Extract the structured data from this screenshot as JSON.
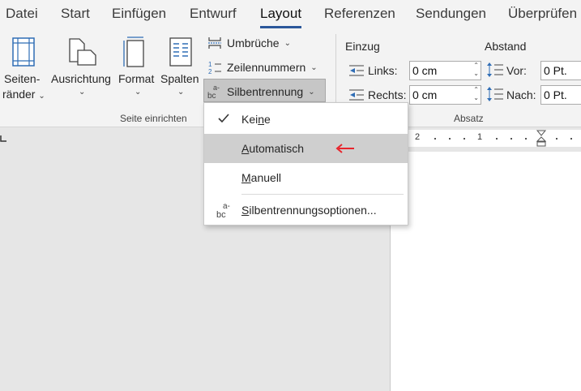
{
  "tabs": [
    "Datei",
    "Start",
    "Einfügen",
    "Entwurf",
    "Layout",
    "Referenzen",
    "Sendungen",
    "Überprüfen"
  ],
  "active_tab": "Layout",
  "ribbon": {
    "seitenraender_line1": "Seiten-",
    "seitenraender_line2": "ränder",
    "ausrichtung": "Ausrichtung",
    "format": "Format",
    "spalten": "Spalten",
    "umbrueche": "Umbrüche",
    "zeilennummern": "Zeilennummern",
    "silbentrennung": "Silbentrennung",
    "group_seite": "Seite einrichten",
    "einzug": "Einzug",
    "abstand": "Abstand",
    "links_label": "Links:",
    "links_value": "0 cm",
    "rechts_label": "Rechts:",
    "rechts_value": "0 cm",
    "vor_label": "Vor:",
    "vor_value": "0 Pt.",
    "nach_label": "Nach:",
    "nach_value": "0 Pt.",
    "group_absatz": "Absatz"
  },
  "menu": {
    "items": [
      {
        "pre": "Kei",
        "ul": "n",
        "post": "e",
        "checked": true
      },
      {
        "pre": "",
        "ul": "A",
        "post": "utomatisch",
        "highlighted": true
      },
      {
        "pre": "",
        "ul": "M",
        "post": "anuell"
      },
      {
        "pre": "",
        "ul": "S",
        "post": "ilbentrennungsoptionen..."
      }
    ]
  },
  "ruler": {
    "labels": [
      "2",
      "1"
    ]
  },
  "colors": {
    "accent": "#2b579a",
    "arrow": "#e8242c",
    "highlight": "#cfcfcf",
    "icon_blue": "#2f6db5"
  }
}
